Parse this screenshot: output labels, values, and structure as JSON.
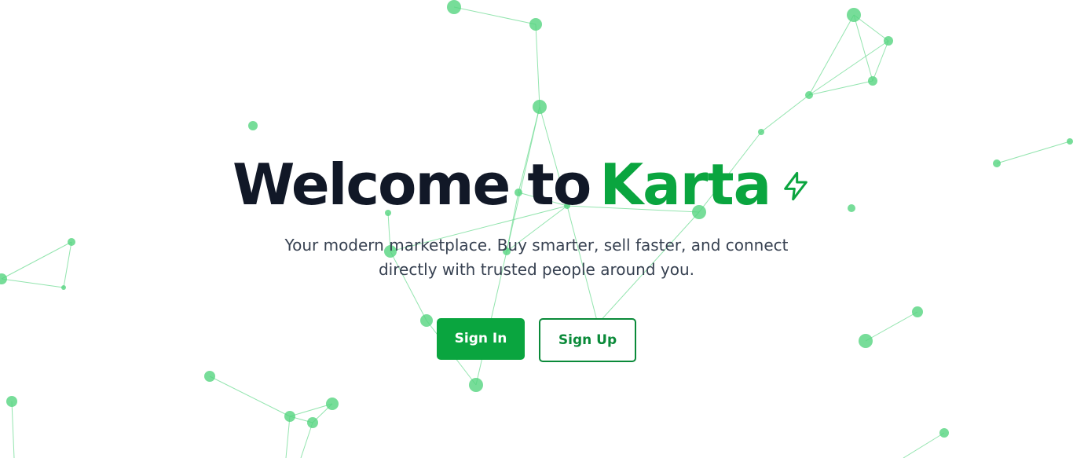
{
  "hero": {
    "title_lead": "Welcome to",
    "title_brand": "Karta",
    "brand_icon": "lightning-bolt-icon",
    "subtitle_line1": "Your modern marketplace. Buy smarter, sell faster, and connect",
    "subtitle_line2": "directly with trusted people around you."
  },
  "actions": {
    "sign_in_label": "Sign In",
    "sign_up_label": "Sign Up"
  },
  "background": {
    "type": "particle-network",
    "node_color": "#55d47f",
    "line_color": "#6fdc94"
  },
  "colors": {
    "brand_green": "#0aa53f",
    "heading_dark": "#111827",
    "text_gray": "#374151",
    "outline_green": "#0a8a39"
  }
}
